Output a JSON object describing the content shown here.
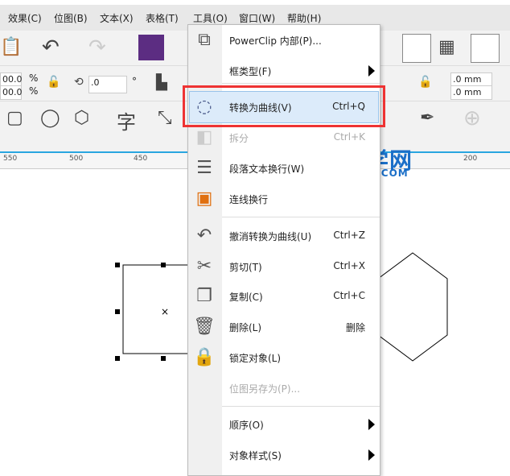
{
  "menubar": {
    "items": [
      "效果(C)",
      "位图(B)",
      "文本(X)",
      "表格(T)",
      "工具(O)",
      "窗口(W)",
      "帮助(H)"
    ]
  },
  "toolbar": {
    "scale_x": "00.0",
    "scale_y": "00.0",
    "percent": "%",
    "rotate": ".0",
    "degree": "°",
    "offset_x": ".0 mm",
    "offset_y": ".0 mm"
  },
  "ruler": {
    "ticks": [
      "550",
      "500",
      "450",
      "200"
    ]
  },
  "context_menu": {
    "items": [
      {
        "label": "PowerClip 内部(P)...",
        "shortcut": "",
        "icon": "powerclip-icon"
      },
      {
        "label": "框类型(F)",
        "shortcut": "",
        "icon": "",
        "submenu": true
      },
      {
        "label": "转换为曲线(V)",
        "shortcut": "Ctrl+Q",
        "icon": "convert-to-curves-icon",
        "highlighted": true
      },
      {
        "label": "拆分",
        "shortcut": "Ctrl+K",
        "icon": "break-apart-icon",
        "disabled": true
      },
      {
        "label": "段落文本换行(W)",
        "shortcut": "",
        "icon": "text-wrap-icon"
      },
      {
        "label": "连线换行",
        "shortcut": "",
        "icon": "line-wrap-icon"
      },
      {
        "label": "撤消转换为曲线(U)",
        "shortcut": "Ctrl+Z",
        "icon": "undo-icon"
      },
      {
        "label": "剪切(T)",
        "shortcut": "Ctrl+X",
        "icon": "scissors-icon"
      },
      {
        "label": "复制(C)",
        "shortcut": "Ctrl+C",
        "icon": "copy-icon"
      },
      {
        "label": "删除(L)",
        "shortcut": "删除",
        "icon": "trash-icon"
      },
      {
        "label": "锁定对象(L)",
        "shortcut": "",
        "icon": "lock-icon"
      },
      {
        "label": "位图另存为(P)...",
        "shortcut": "",
        "icon": "",
        "disabled": true
      },
      {
        "label": "顺序(O)",
        "shortcut": "",
        "icon": "",
        "submenu": true
      },
      {
        "label": "对象样式(S)",
        "shortcut": "",
        "icon": "",
        "submenu": true
      }
    ]
  },
  "watermark": {
    "title": "软件自学网",
    "url": "WWW.RJZXW.COM"
  },
  "colors": {
    "highlight": "#dcebfa",
    "annotation": "#ee3333",
    "watermark": "#1b6fc8"
  }
}
